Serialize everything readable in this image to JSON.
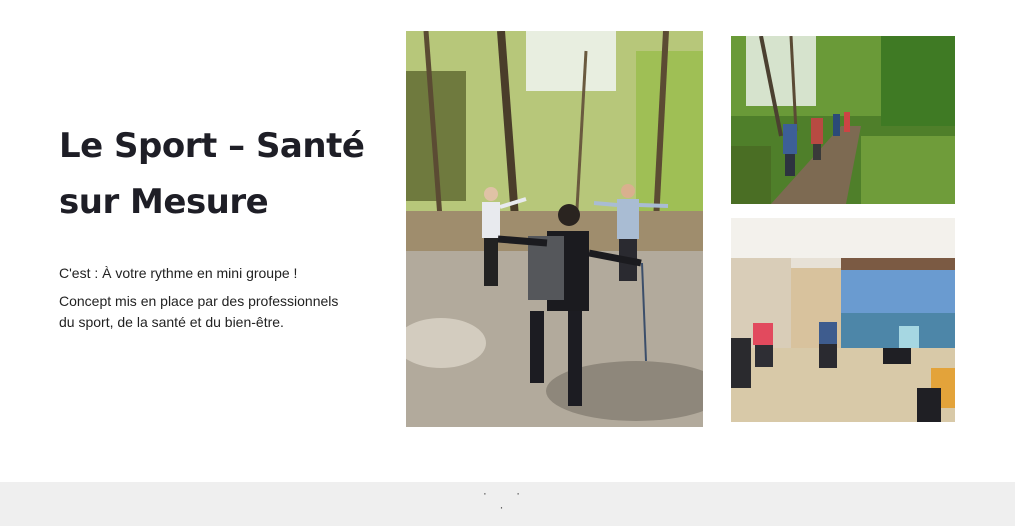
{
  "hero": {
    "title_line1": "Le Sport – Santé",
    "title_line2": "sur Mesure",
    "paragraph1": "C'est : À votre rythme en mini groupe !",
    "paragraph2": "Concept mis en place par des professionnels du sport, de la santé et du bien-être."
  },
  "photos": [
    {
      "name": "forest-exercise-photo"
    },
    {
      "name": "forest-trail-photo"
    },
    {
      "name": "indoor-chair-exercise-photo"
    }
  ],
  "footer": {
    "dots": "· · ·"
  }
}
